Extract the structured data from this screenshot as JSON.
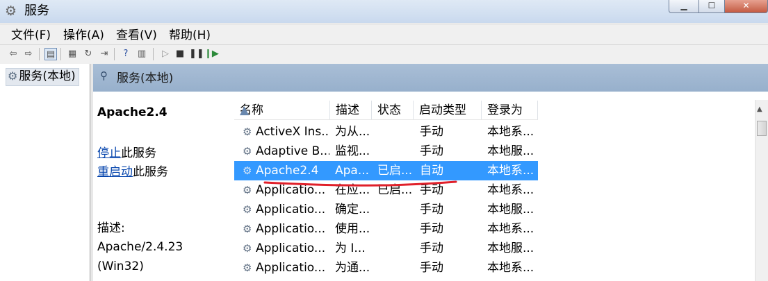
{
  "window": {
    "title": "服务"
  },
  "menu": [
    "文件(F)",
    "操作(A)",
    "查看(V)",
    "帮助(H)"
  ],
  "tree": {
    "root_label": "服务(本地)"
  },
  "header": {
    "title": "服务(本地)"
  },
  "details": {
    "service_name": "Apache2.4",
    "stop_link": "停止",
    "stop_suffix": "此服务",
    "restart_link": "重启动",
    "restart_suffix": "此服务",
    "desc_label": "描述:",
    "desc_line1": "Apache/2.4.23",
    "desc_line2": "(Win32)"
  },
  "list": {
    "columns": [
      "名称",
      "描述",
      "状态",
      "启动类型",
      "登录为"
    ],
    "rows": [
      {
        "name": "ActiveX Ins...",
        "desc": "为从...",
        "status": "",
        "startup": "手动",
        "logon": "本地系..."
      },
      {
        "name": "Adaptive B...",
        "desc": "监视...",
        "status": "",
        "startup": "手动",
        "logon": "本地服..."
      },
      {
        "name": "Apache2.4",
        "desc": "Apa...",
        "status": "已启...",
        "startup": "自动",
        "logon": "本地系...",
        "selected": true
      },
      {
        "name": "Applicatio...",
        "desc": "在应...",
        "status": "已启...",
        "startup": "手动",
        "logon": "本地系..."
      },
      {
        "name": "Applicatio...",
        "desc": "确定...",
        "status": "",
        "startup": "手动",
        "logon": "本地服..."
      },
      {
        "name": "Applicatio...",
        "desc": "使用...",
        "status": "",
        "startup": "手动",
        "logon": "本地系..."
      },
      {
        "name": "Applicatio...",
        "desc": "为 I...",
        "status": "",
        "startup": "手动",
        "logon": "本地服..."
      },
      {
        "name": "Applicatio...",
        "desc": "为通...",
        "status": "",
        "startup": "手动",
        "logon": "本地系..."
      }
    ]
  },
  "colors": {
    "selection": "#3399ff",
    "header_band": "#a9bed6",
    "annotation": "#e0202a"
  }
}
